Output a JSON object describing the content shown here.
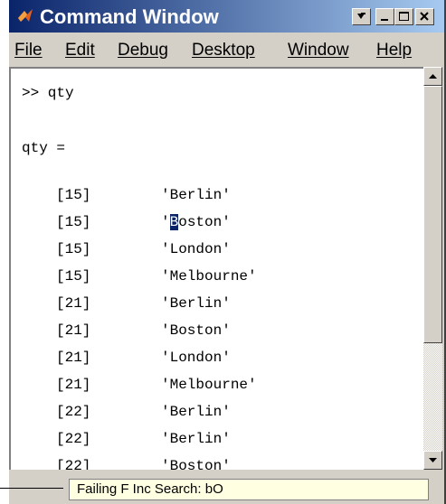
{
  "window": {
    "title": "Command Window"
  },
  "menu": {
    "items": [
      "File",
      "Edit",
      "Debug",
      "Desktop",
      "Window",
      "Help"
    ]
  },
  "console": {
    "prompt_line": ">> qty",
    "var_line": "qty =",
    "rows": [
      {
        "qty": "[15]",
        "city": "'Berlin'"
      },
      {
        "qty": "[15]",
        "city_open": "'",
        "city_sel": "B",
        "city_rest": "oston'"
      },
      {
        "qty": "[15]",
        "city": "'London'"
      },
      {
        "qty": "[15]",
        "city": "'Melbourne'"
      },
      {
        "qty": "[21]",
        "city": "'Berlin'"
      },
      {
        "qty": "[21]",
        "city": "'Boston'"
      },
      {
        "qty": "[21]",
        "city": "'London'"
      },
      {
        "qty": "[21]",
        "city": "'Melbourne'"
      },
      {
        "qty": "[22]",
        "city": "'Berlin'"
      },
      {
        "qty": "[22]",
        "city": "'Berlin'"
      },
      {
        "qty": "[22]",
        "city": "'Boston'"
      }
    ]
  },
  "status": {
    "text": "Failing F Inc Search: bO"
  },
  "colors": {
    "title_bar": "#0a246a",
    "selection": "#0a246a",
    "status_background": "#ffffe1",
    "chrome": "#d4d0c8"
  }
}
